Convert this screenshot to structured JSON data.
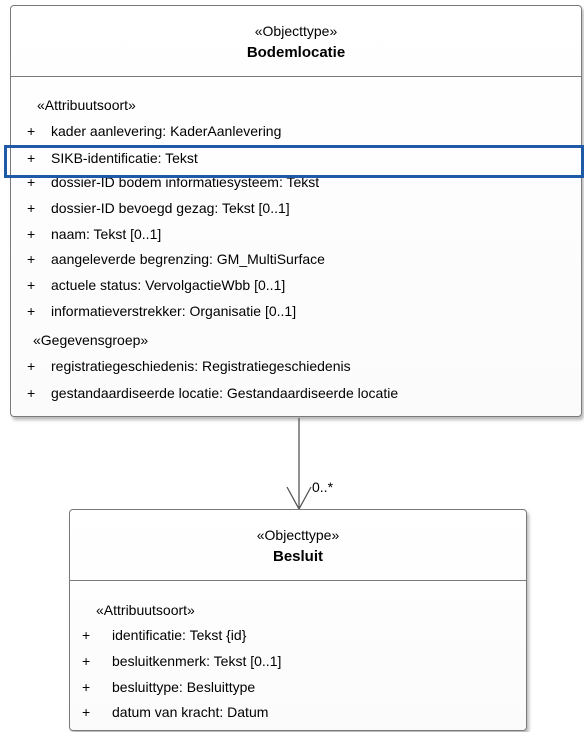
{
  "bodemlocatie": {
    "stereotype": "«Objecttype»",
    "name": "Bodemlocatie",
    "attr_section_label": "«Attribuutsoort»",
    "attributes": [
      {
        "vis": "+",
        "text": "kader aanlevering: KaderAanlevering"
      },
      {
        "vis": "+",
        "text": "SIKB-identificatie: Tekst"
      },
      {
        "vis": "+",
        "text": "dossier-ID bodem informatiesysteem: Tekst"
      },
      {
        "vis": "+",
        "text": "dossier-ID bevoegd gezag: Tekst [0..1]"
      },
      {
        "vis": "+",
        "text": "naam: Tekst [0..1]"
      },
      {
        "vis": "+",
        "text": "aangeleverde begrenzing: GM_MultiSurface"
      },
      {
        "vis": "+",
        "text": "actuele status: VervolgactieWbb [0..1]"
      },
      {
        "vis": "+",
        "text": "informatieverstrekker: Organisatie [0..1]"
      }
    ],
    "group_section_label": "«Gegevensgroep»",
    "groups": [
      {
        "vis": "+",
        "text": "registratiegeschiedenis: Registratiegeschiedenis"
      },
      {
        "vis": "+",
        "text": "gestandaardiseerde locatie: Gestandaardiseerde locatie"
      }
    ]
  },
  "association": {
    "multiplicity": "0..*"
  },
  "besluit": {
    "stereotype": "«Objecttype»",
    "name": "Besluit",
    "attr_section_label": "«Attribuutsoort»",
    "attributes": [
      {
        "vis": "+",
        "text": "identificatie: Tekst {id}"
      },
      {
        "vis": "+",
        "text": "besluitkenmerk: Tekst [0..1]"
      },
      {
        "vis": "+",
        "text": "besluittype: Besluittype"
      },
      {
        "vis": "+",
        "text": "datum van kracht: Datum"
      }
    ]
  },
  "colors": {
    "highlight": "#1f5aa6",
    "border": "#7a7a7a"
  }
}
